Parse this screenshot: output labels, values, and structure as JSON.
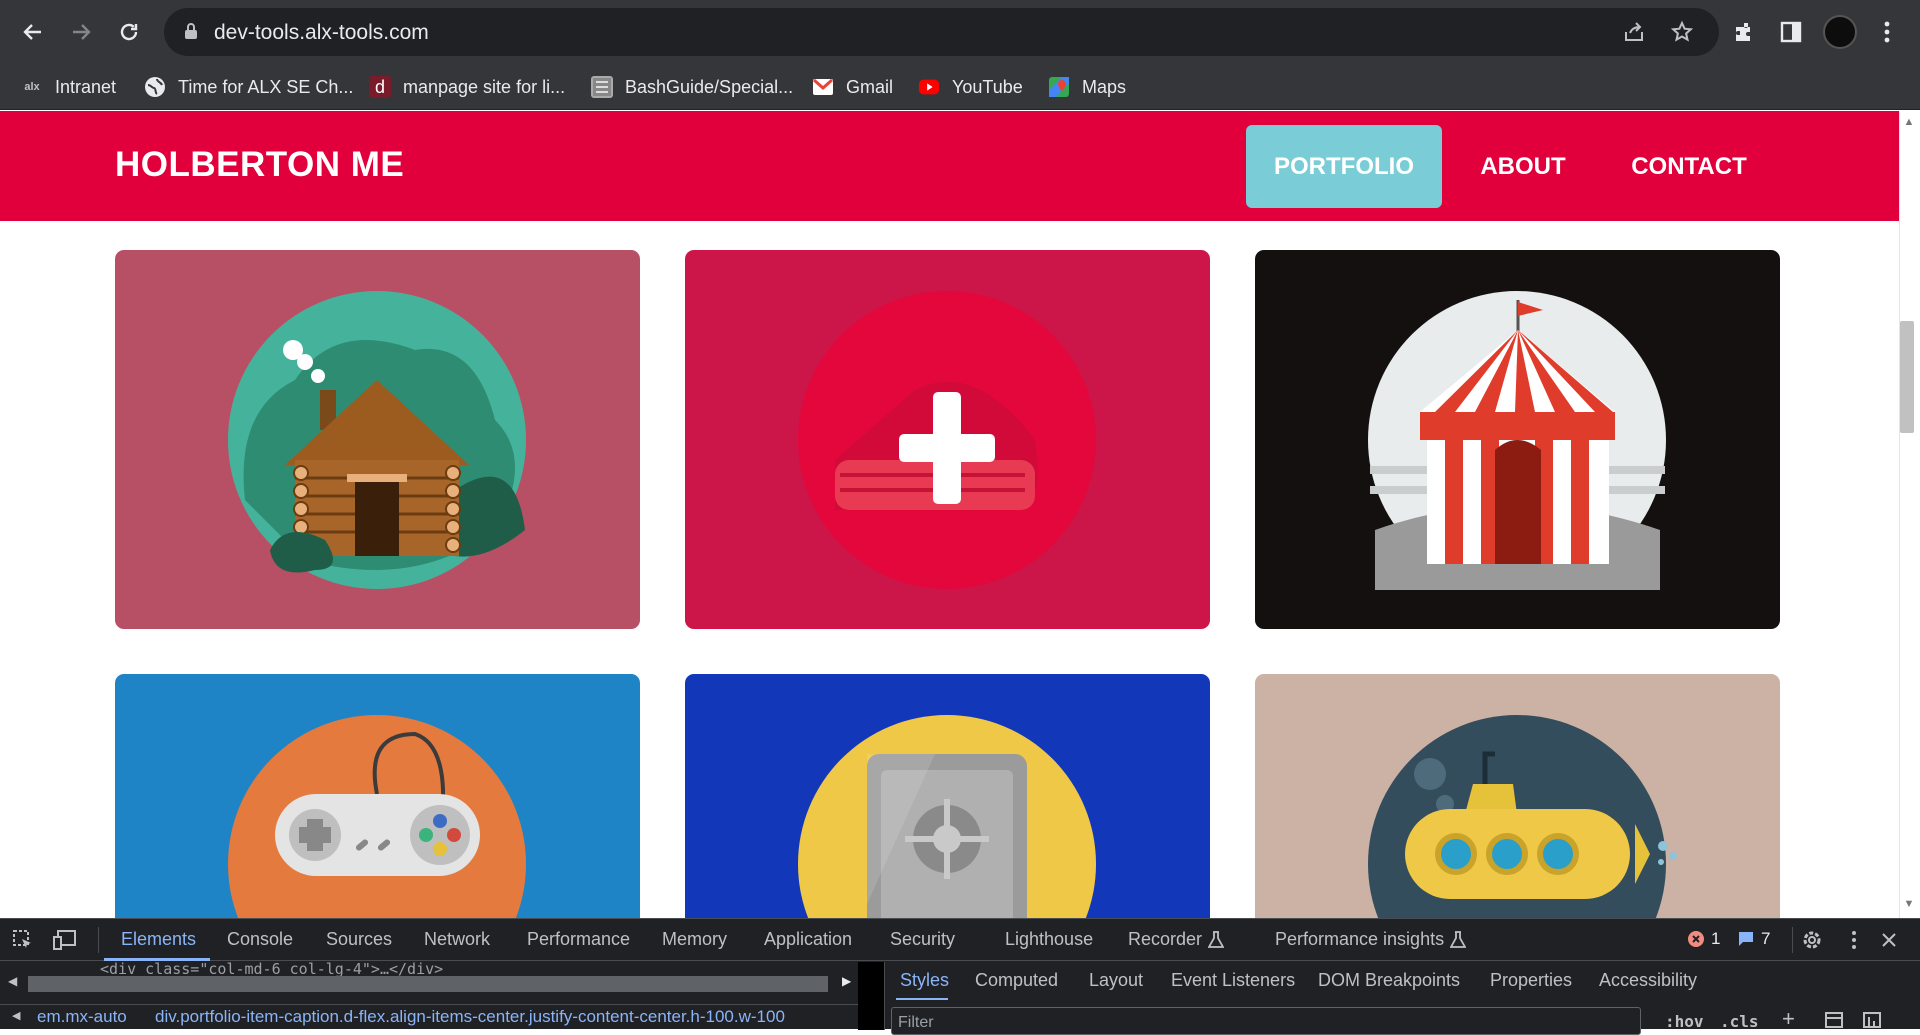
{
  "browser": {
    "url": "dev-tools.alx-tools.com",
    "bookmarks": [
      {
        "label": "Intranet",
        "icon": "alx-icon"
      },
      {
        "label": "Time for ALX SE Ch...",
        "icon": "globe-icon"
      },
      {
        "label": "manpage site for li...",
        "icon": "d-icon"
      },
      {
        "label": "BashGuide/Special...",
        "icon": "bash-icon"
      },
      {
        "label": "Gmail",
        "icon": "gmail-icon"
      },
      {
        "label": "YouTube",
        "icon": "youtube-icon"
      },
      {
        "label": "Maps",
        "icon": "maps-icon"
      }
    ]
  },
  "site": {
    "brand": "HOLBERTON ME",
    "menu": [
      {
        "label": "PORTFOLIO",
        "active": true
      },
      {
        "label": "ABOUT",
        "active": false
      },
      {
        "label": "CONTACT",
        "active": false
      }
    ],
    "portfolio_items": [
      {
        "name": "cabin",
        "bg": "#b85065"
      },
      {
        "name": "cake",
        "bg": "#cc1549"
      },
      {
        "name": "circus",
        "bg": "#141010"
      },
      {
        "name": "game",
        "bg": "#1e84c5"
      },
      {
        "name": "safe",
        "bg": "#1237b8"
      },
      {
        "name": "submarine",
        "bg": "#cbb2a4"
      }
    ]
  },
  "devtools": {
    "tabs": [
      "Elements",
      "Console",
      "Sources",
      "Network",
      "Performance",
      "Memory",
      "Application",
      "Security",
      "Lighthouse",
      "Recorder",
      "Performance insights"
    ],
    "active_tab": "Elements",
    "error_count": "1",
    "message_count": "7",
    "code_line": "<div class=\"col-md-6 col-lg-4\">…</div>",
    "breadcrumbs": [
      "em.mx-auto",
      "div.portfolio-item-caption.d-flex.align-items-center.justify-content-center.h-100.w-100"
    ],
    "styles_tabs": [
      "Styles",
      "Computed",
      "Layout",
      "Event Listeners",
      "DOM Breakpoints",
      "Properties",
      "Accessibility"
    ],
    "styles_active": "Styles",
    "filter_placeholder": "Filter",
    "hov": ":hov",
    "cls": ".cls"
  }
}
